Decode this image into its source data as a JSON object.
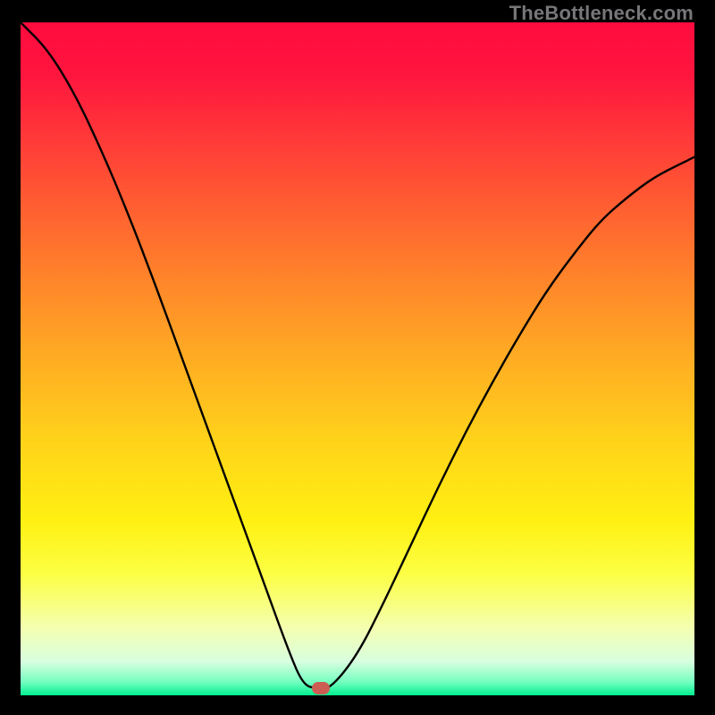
{
  "watermark": "TheBottleneck.com",
  "marker": {
    "cx_frac": 0.445,
    "cy_frac": 0.99
  },
  "chart_data": {
    "type": "line",
    "title": "",
    "xlabel": "",
    "ylabel": "",
    "xlim": [
      0,
      1
    ],
    "ylim": [
      0,
      1
    ],
    "series": [
      {
        "name": "curve",
        "x": [
          0.0,
          0.04,
          0.08,
          0.12,
          0.16,
          0.2,
          0.24,
          0.28,
          0.32,
          0.36,
          0.4,
          0.42,
          0.44,
          0.46,
          0.5,
          0.54,
          0.58,
          0.62,
          0.66,
          0.7,
          0.74,
          0.78,
          0.82,
          0.86,
          0.9,
          0.94,
          0.98,
          1.0
        ],
        "y": [
          1.0,
          0.96,
          0.895,
          0.81,
          0.715,
          0.61,
          0.5,
          0.39,
          0.28,
          0.17,
          0.06,
          0.015,
          0.01,
          0.01,
          0.06,
          0.14,
          0.225,
          0.31,
          0.39,
          0.465,
          0.535,
          0.6,
          0.655,
          0.705,
          0.74,
          0.77,
          0.79,
          0.8
        ]
      }
    ],
    "background_gradient": {
      "top_color": "#ff0b3e",
      "bottom_color": "#00f090"
    },
    "marker_point": {
      "x": 0.445,
      "y": 0.01,
      "color": "#cb5d53"
    }
  }
}
